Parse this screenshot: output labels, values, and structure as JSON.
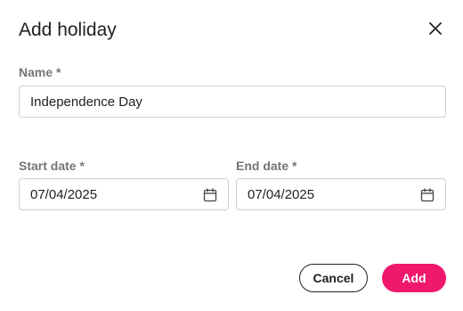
{
  "dialog": {
    "title": "Add holiday",
    "close_icon": "close-icon"
  },
  "form": {
    "name": {
      "label": "Name *",
      "value": "Independence Day"
    },
    "start_date": {
      "label": "Start date *",
      "value": "07/04/2025",
      "icon": "calendar-icon"
    },
    "end_date": {
      "label": "End date *",
      "value": "07/04/2025",
      "icon": "calendar-icon"
    }
  },
  "actions": {
    "cancel_label": "Cancel",
    "add_label": "Add"
  },
  "colors": {
    "accent": "#f0186c",
    "text": "#212121",
    "label": "#757575",
    "border": "#cfcfcf"
  }
}
